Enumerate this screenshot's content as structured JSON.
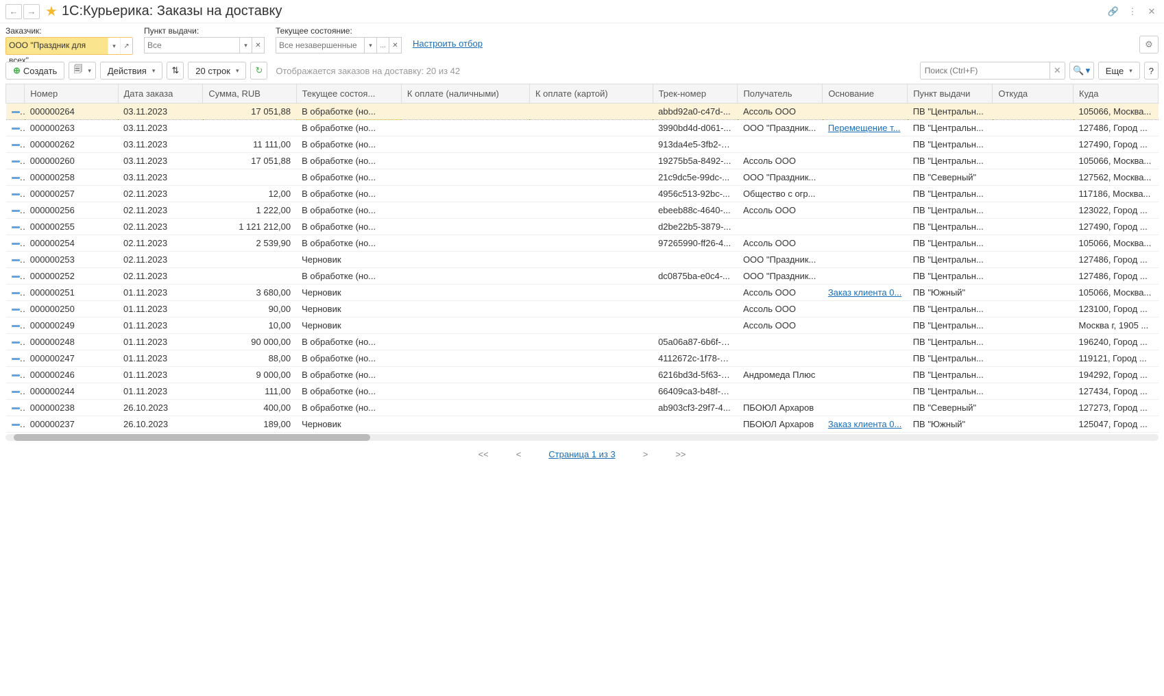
{
  "header": {
    "title": "1C:Курьерика: Заказы на доставку"
  },
  "filters": {
    "customer_label": "Заказчик:",
    "customer_value": "ООО \"Праздник для всех\"",
    "pickup_label": "Пункт выдачи:",
    "pickup_placeholder": "Все",
    "state_label": "Текущее состояние:",
    "state_placeholder": "Все незавершенные",
    "configure_link": "Настроить отбор"
  },
  "toolbar": {
    "create": "Создать",
    "actions": "Действия",
    "rows": "20 строк",
    "status": "Отображается заказов на доставку: 20 из 42",
    "search_placeholder": "Поиск (Ctrl+F)",
    "more": "Еще"
  },
  "columns": {
    "number": "Номер",
    "date": "Дата заказа",
    "sum": "Сумма, RUB",
    "state": "Текущее состоя...",
    "pay_cash": "К оплате (наличными)",
    "pay_card": "К оплате (картой)",
    "track": "Трек-номер",
    "recipient": "Получатель",
    "basis": "Основание",
    "pickup": "Пункт выдачи",
    "from": "Откуда",
    "to": "Куда"
  },
  "rows": [
    {
      "number": "000000264",
      "date": "03.11.2023",
      "sum": "17 051,88",
      "state": "В обработке (но...",
      "track": "abbd92a0-c47d-...",
      "recipient": "Ассоль ООО",
      "basis": "",
      "pickup": "ПВ \"Центральн...",
      "to": "105066, Москва...",
      "selected": true
    },
    {
      "number": "000000263",
      "date": "03.11.2023",
      "sum": "",
      "state": "В обработке (но...",
      "track": "3990bd4d-d061-...",
      "recipient": "ООО \"Праздник...",
      "basis": "Перемещение т...",
      "pickup": "ПВ \"Центральн...",
      "to": "127486, Город ..."
    },
    {
      "number": "000000262",
      "date": "03.11.2023",
      "sum": "11 111,00",
      "state": "В обработке (но...",
      "track": "913da4e5-3fb2-4...",
      "recipient": "",
      "basis": "",
      "pickup": "ПВ \"Центральн...",
      "to": "127490, Город ..."
    },
    {
      "number": "000000260",
      "date": "03.11.2023",
      "sum": "17 051,88",
      "state": "В обработке (но...",
      "track": "19275b5a-8492-...",
      "recipient": "Ассоль ООО",
      "basis": "",
      "pickup": "ПВ \"Центральн...",
      "to": "105066, Москва..."
    },
    {
      "number": "000000258",
      "date": "03.11.2023",
      "sum": "",
      "state": "В обработке (но...",
      "track": "21c9dc5e-99dc-...",
      "recipient": "ООО \"Праздник...",
      "basis": "",
      "pickup": "ПВ \"Северный\"",
      "to": "127562, Москва..."
    },
    {
      "number": "000000257",
      "date": "02.11.2023",
      "sum": "12,00",
      "state": "В обработке (но...",
      "track": "4956c513-92bc-...",
      "recipient": "Общество с огр...",
      "basis": "",
      "pickup": "ПВ \"Центральн...",
      "to": "117186, Москва..."
    },
    {
      "number": "000000256",
      "date": "02.11.2023",
      "sum": "1 222,00",
      "state": "В обработке (но...",
      "track": "ebeeb88c-4640-...",
      "recipient": "Ассоль ООО",
      "basis": "",
      "pickup": "ПВ \"Центральн...",
      "to": "123022, Город ..."
    },
    {
      "number": "000000255",
      "date": "02.11.2023",
      "sum": "1 121 212,00",
      "state": "В обработке (но...",
      "track": "d2be22b5-3879-...",
      "recipient": "",
      "basis": "",
      "pickup": "ПВ \"Центральн...",
      "to": "127490, Город ..."
    },
    {
      "number": "000000254",
      "date": "02.11.2023",
      "sum": "2 539,90",
      "state": "В обработке (но...",
      "track": "97265990-ff26-4...",
      "recipient": "Ассоль ООО",
      "basis": "",
      "pickup": "ПВ \"Центральн...",
      "to": "105066, Москва..."
    },
    {
      "number": "000000253",
      "date": "02.11.2023",
      "sum": "",
      "state": "Черновик",
      "track": "",
      "recipient": "ООО \"Праздник...",
      "basis": "",
      "pickup": "ПВ \"Центральн...",
      "to": "127486, Город ..."
    },
    {
      "number": "000000252",
      "date": "02.11.2023",
      "sum": "",
      "state": "В обработке (но...",
      "track": "dc0875ba-e0c4-...",
      "recipient": "ООО \"Праздник...",
      "basis": "",
      "pickup": "ПВ \"Центральн...",
      "to": "127486, Город ..."
    },
    {
      "number": "000000251",
      "date": "01.11.2023",
      "sum": "3 680,00",
      "state": "Черновик",
      "track": "",
      "recipient": "Ассоль ООО",
      "basis": "Заказ клиента 0...",
      "pickup": "ПВ \"Южный\"",
      "to": "105066, Москва..."
    },
    {
      "number": "000000250",
      "date": "01.11.2023",
      "sum": "90,00",
      "state": "Черновик",
      "track": "",
      "recipient": "Ассоль ООО",
      "basis": "",
      "pickup": "ПВ \"Центральн...",
      "to": "123100, Город ..."
    },
    {
      "number": "000000249",
      "date": "01.11.2023",
      "sum": "10,00",
      "state": "Черновик",
      "track": "",
      "recipient": "Ассоль ООО",
      "basis": "",
      "pickup": "ПВ \"Центральн...",
      "to": "Москва г, 1905 ..."
    },
    {
      "number": "000000248",
      "date": "01.11.2023",
      "sum": "90 000,00",
      "state": "В обработке (но...",
      "track": "05a06a87-6b6f-4...",
      "recipient": "",
      "basis": "",
      "pickup": "ПВ \"Центральн...",
      "to": "196240, Город ..."
    },
    {
      "number": "000000247",
      "date": "01.11.2023",
      "sum": "88,00",
      "state": "В обработке (но...",
      "track": "4112672c-1f78-4...",
      "recipient": "",
      "basis": "",
      "pickup": "ПВ \"Центральн...",
      "to": "119121, Город ..."
    },
    {
      "number": "000000246",
      "date": "01.11.2023",
      "sum": "9 000,00",
      "state": "В обработке (но...",
      "track": "6216bd3d-5f63-4...",
      "recipient": "Андромеда Плюс",
      "basis": "",
      "pickup": "ПВ \"Центральн...",
      "to": "194292, Город ..."
    },
    {
      "number": "000000244",
      "date": "01.11.2023",
      "sum": "111,00",
      "state": "В обработке (но...",
      "track": "66409ca3-b48f-4...",
      "recipient": "",
      "basis": "",
      "pickup": "ПВ \"Центральн...",
      "to": "127434, Город ..."
    },
    {
      "number": "000000238",
      "date": "26.10.2023",
      "sum": "400,00",
      "state": "В обработке (но...",
      "track": "ab903cf3-29f7-4...",
      "recipient": "ПБОЮЛ Архаров",
      "basis": "",
      "pickup": "ПВ \"Северный\"",
      "to": "127273, Город ..."
    },
    {
      "number": "000000237",
      "date": "26.10.2023",
      "sum": "189,00",
      "state": "Черновик",
      "track": "",
      "recipient": "ПБОЮЛ Архаров",
      "basis": "Заказ клиента 0...",
      "pickup": "ПВ \"Южный\"",
      "to": "125047, Город ..."
    }
  ],
  "pagination": {
    "page": "Страница 1 из 3"
  }
}
